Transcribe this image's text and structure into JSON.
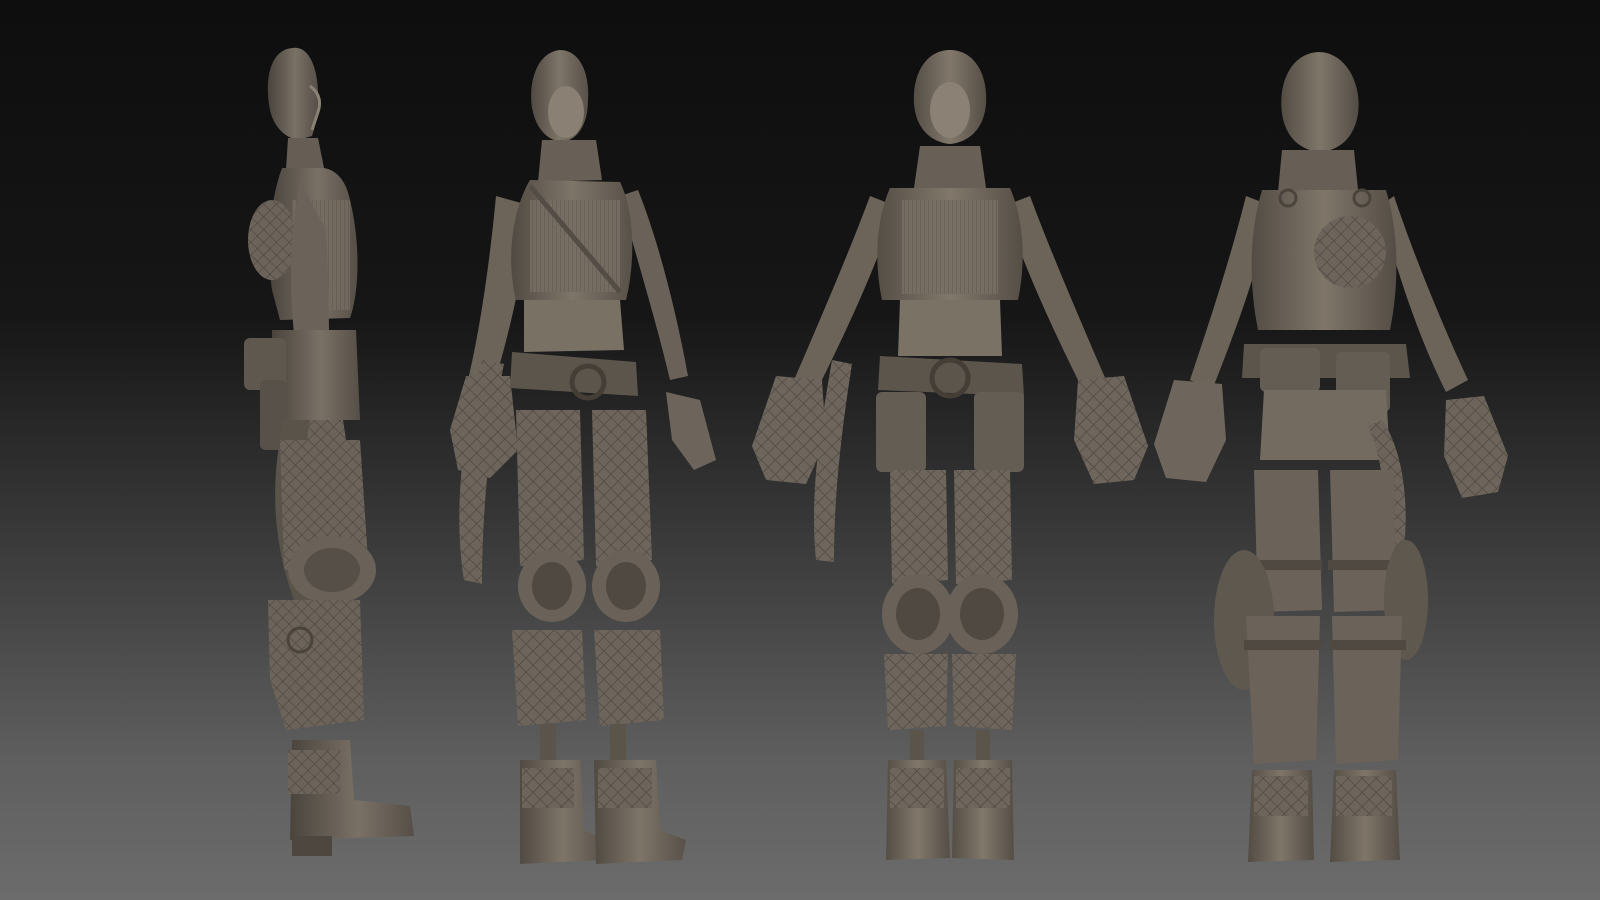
{
  "scene": {
    "type": "3d-sculpt-turnaround",
    "background": {
      "top": "#0e0e0e",
      "bottom": "#6c6c6c"
    },
    "model_color": "#6f675e",
    "model_shadow": "#4a443d",
    "model_highlight": "#978d80",
    "views": [
      {
        "name": "side"
      },
      {
        "name": "three-quarter"
      },
      {
        "name": "front"
      },
      {
        "name": "back"
      }
    ]
  }
}
